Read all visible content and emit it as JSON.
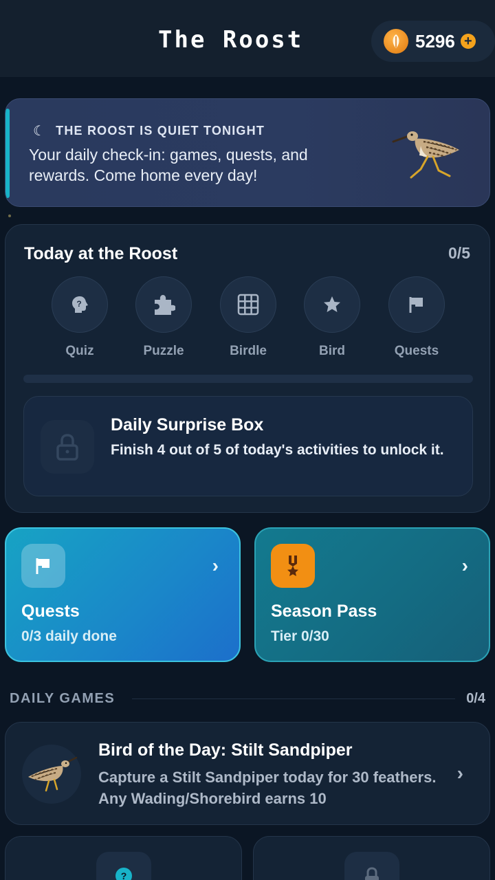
{
  "header": {
    "title": "The Roost",
    "coins": "5296",
    "add_label": "+"
  },
  "banner": {
    "kicker": "THE ROOST IS QUIET TONIGHT",
    "text": "Your daily check-in: games, quests, and rewards. Come home every day!",
    "accent_color": "#18b3c9"
  },
  "today": {
    "title": "Today at the Roost",
    "count": "0/5",
    "activities": [
      {
        "label": "Quiz",
        "icon": "brain-question-icon"
      },
      {
        "label": "Puzzle",
        "icon": "puzzle-icon"
      },
      {
        "label": "Birdle",
        "icon": "grid-icon"
      },
      {
        "label": "Bird",
        "icon": "star-icon"
      },
      {
        "label": "Quests",
        "icon": "flag-icon"
      }
    ],
    "progress": 0,
    "surprise": {
      "title": "Daily Surprise Box",
      "desc": "Finish 4 out of 5 of today's activities to unlock it."
    }
  },
  "tiles": {
    "quests": {
      "title": "Quests",
      "sub": "0/3 daily done"
    },
    "season": {
      "title": "Season Pass",
      "sub": "Tier 0/30"
    }
  },
  "daily_games": {
    "title": "DAILY GAMES",
    "count": "0/4",
    "bird_of_day": {
      "title": "Bird of the Day: Stilt Sandpiper",
      "desc": "Capture a Stilt Sandpiper today for 30 feathers. Any Wading/Shorebird earns 10"
    }
  },
  "colors": {
    "background": "#0b1624",
    "coin": "#f4a21c",
    "quests_tile": "#1a86c9",
    "season_tile": "#146b82"
  }
}
